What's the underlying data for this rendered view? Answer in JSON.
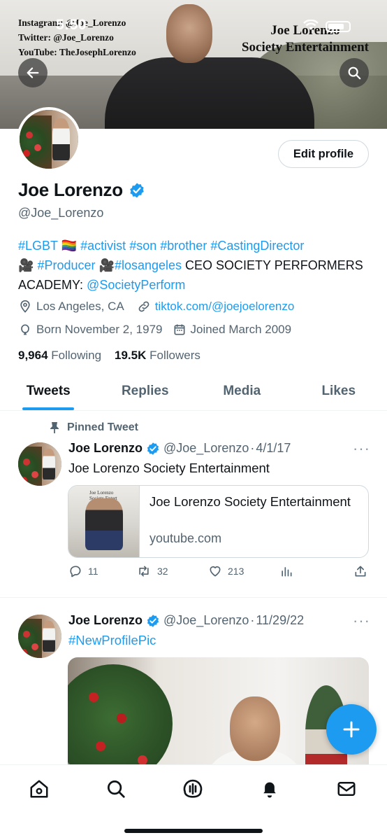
{
  "status_bar": {
    "time": "5:50"
  },
  "banner": {
    "text_left": [
      "Instagram: @Joe_Lorenzo",
      "Twitter: @Joe_Lorenzo",
      "YouTube: TheJosephLorenzo"
    ],
    "text_right": [
      "Joe Lorenzo",
      "Society Entertainment"
    ]
  },
  "profile": {
    "edit_label": "Edit profile",
    "name": "Joe Lorenzo",
    "handle": "@Joe_Lorenzo",
    "bio": {
      "tag_lgbt": "#LGBT",
      "rainbow": "🏳️‍🌈",
      "tag_activist": "#activist",
      "tag_son": "#son",
      "tag_brother": "#brother",
      "tag_casting": "#CastingDirector",
      "camera1": "🎥",
      "tag_producer": "#Producer",
      "camera2": "🎥",
      "tag_la": "#losangeles",
      "text_ceo": "CEO SOCIETY PERFORMERS ACADEMY:",
      "mention": "@SocietyPerform"
    },
    "location": "Los Angeles, CA",
    "website": "tiktok.com/@joejoelorenzo",
    "born": "Born November 2, 1979",
    "joined": "Joined March 2009",
    "following_count": "9,964",
    "following_label": "Following",
    "followers_count": "19.5K",
    "followers_label": "Followers"
  },
  "tabs": [
    "Tweets",
    "Replies",
    "Media",
    "Likes"
  ],
  "tweets": [
    {
      "pinned_label": "Pinned Tweet",
      "name": "Joe Lorenzo",
      "handle": "@Joe_Lorenzo",
      "sep": "·",
      "date": "4/1/17",
      "more": "···",
      "text": "Joe Lorenzo Society Entertainment",
      "card": {
        "thumb_text": [
          "Joe Lorenzo",
          "Society Entert"
        ],
        "title": "Joe Lorenzo Society Entertainment",
        "domain": "youtube.com"
      },
      "replies": "11",
      "retweets": "32",
      "likes": "213"
    },
    {
      "name": "Joe Lorenzo",
      "handle": "@Joe_Lorenzo",
      "sep": "·",
      "date": "11/29/22",
      "more": "···",
      "text": "#NewProfilePic"
    }
  ],
  "colors": {
    "accent": "#1d9bf0",
    "text": "#0f1419",
    "muted": "#536471",
    "border": "#cfd9de"
  },
  "icons": [
    "back-arrow-icon",
    "search-icon",
    "verified-badge-icon",
    "location-pin-icon",
    "link-icon",
    "balloon-icon",
    "calendar-icon",
    "pin-icon",
    "reply-icon",
    "retweet-icon",
    "heart-icon",
    "analytics-icon",
    "share-icon",
    "compose-plus-icon",
    "home-icon",
    "explore-icon",
    "spaces-icon",
    "notifications-icon",
    "messages-icon"
  ]
}
